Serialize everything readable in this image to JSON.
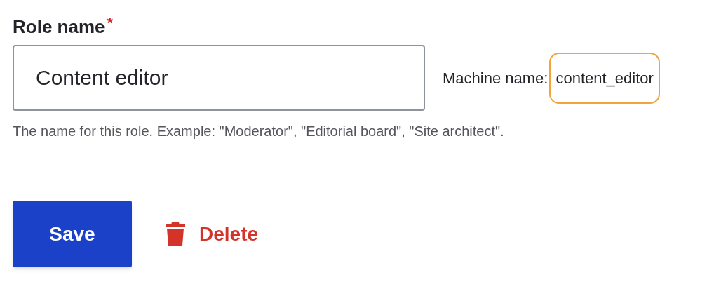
{
  "field": {
    "label": "Role name",
    "required_mark": "*",
    "value": "Content editor",
    "machine_name_label": "Machine name:",
    "machine_name": "content_editor",
    "description": "The name for this role. Example: \"Moderator\", \"Editorial board\", \"Site architect\"."
  },
  "actions": [
    {
      "kind": "primary",
      "label": "Save"
    },
    {
      "kind": "danger",
      "label": "Delete"
    }
  ]
}
